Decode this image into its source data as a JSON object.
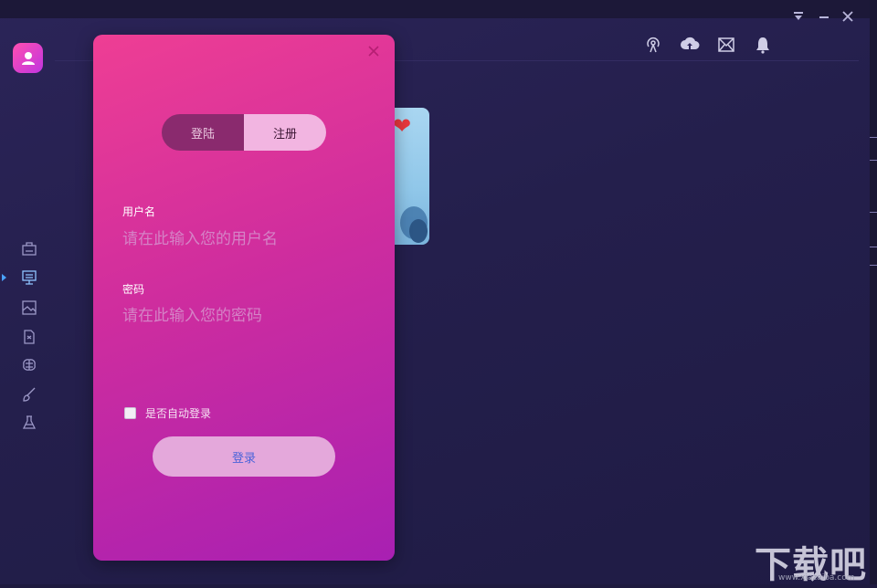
{
  "panel": {
    "tabs": [
      {
        "label": "登陆"
      },
      {
        "label": "注册"
      }
    ],
    "username": {
      "label": "用户名",
      "placeholder": "请在此输入您的用户名"
    },
    "password": {
      "label": "密码",
      "placeholder": "请在此输入您的密码"
    },
    "auto_login": {
      "label": "是否自动登录",
      "checked": false
    },
    "login_button": "登录"
  },
  "sidebar": {
    "icons": [
      "robot-doc-icon",
      "screen-icon",
      "image-icon",
      "document-icon",
      "brain-icon",
      "paint-brush-icon",
      "flask-icon"
    ],
    "active_index": 1
  },
  "topbar": {
    "icons": [
      "broadcast-icon",
      "cloud-upload-icon",
      "mail-icon",
      "bell-icon"
    ]
  },
  "window_controls": [
    "dropdown-icon",
    "minimize-icon",
    "close-icon"
  ],
  "watermark": {
    "text": "下载吧",
    "sub": "www.xiazaiba.com"
  },
  "colors": {
    "panel_top": "#ee3e94",
    "panel_bottom": "#a820b2",
    "background": "#241f4c",
    "accent": "#4aa3ff"
  }
}
